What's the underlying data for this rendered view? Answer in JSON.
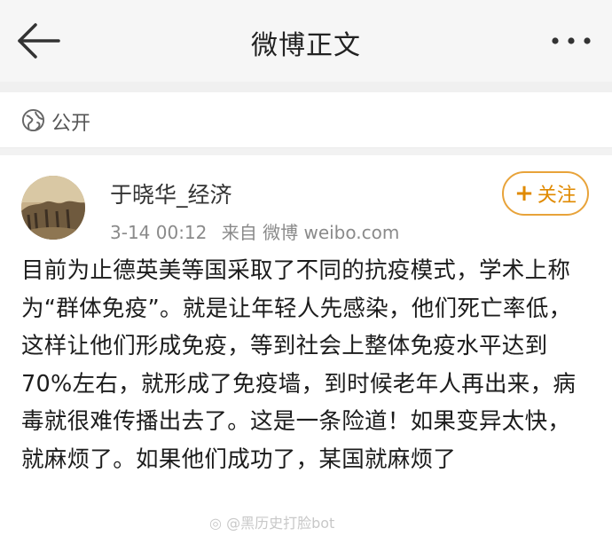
{
  "header": {
    "title": "微博正文",
    "back_icon": "back-arrow-icon",
    "more_icon": "more-dots-icon"
  },
  "visibility": {
    "label": "公开",
    "icon": "globe-icon"
  },
  "post": {
    "author": "于晓华_经济",
    "time": "3-14 00:12",
    "source": "来自 微博 weibo.com",
    "follow_label": "关注",
    "text": "目前为止德英美等国采取了不同的抗疫模式，学术上称为“群体免疫”。就是让年轻人先感染，他们死亡率低，这样让他们形成免疫，等到社会上整体免疫水平达到70%左右，就形成了免疫墙，到时候老年人再出来，病毒就很难传播出去了。这是一条险道！如果变异太快，就麻烦了。如果他们成功了，某国就麻烦了"
  },
  "watermark": {
    "text": "@黑历史打脸bot",
    "icon": "weibo-logo-icon"
  },
  "colors": {
    "accent": "#e8a33a",
    "header_bg": "#f6f6f6"
  }
}
